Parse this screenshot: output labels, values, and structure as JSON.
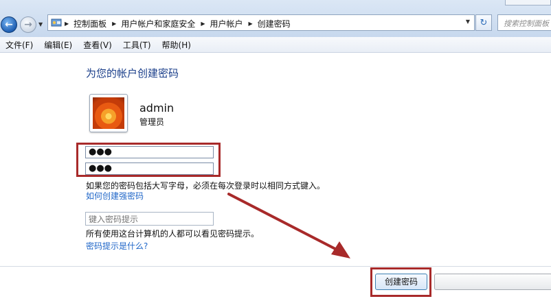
{
  "address_bar": {
    "breadcrumbs": [
      "控制面板",
      "用户帐户和家庭安全",
      "用户帐户",
      "创建密码"
    ],
    "search_placeholder": "搜索控制面板"
  },
  "menu": {
    "items": [
      "文件(F)",
      "编辑(E)",
      "查看(V)",
      "工具(T)",
      "帮助(H)"
    ]
  },
  "main": {
    "title": "为您的帐户创建密码",
    "user": {
      "name": "admin",
      "role": "管理员"
    },
    "new_password_value": "●●●",
    "confirm_password_value": "●●●",
    "case_note": "如果您的密码包括大写字母，必须在每次登录时以相同方式键入。",
    "strong_password_link": "如何创建强密码",
    "hint_placeholder": "键入密码提示",
    "hint_note": "所有使用这台计算机的人都可以看见密码提示。",
    "hint_link": "密码提示是什么?"
  },
  "footer": {
    "create_button": "创建密码"
  },
  "colors": {
    "annotation": "#a82a2a",
    "title_blue": "#1a3e8a",
    "link_blue": "#1f66c8"
  }
}
